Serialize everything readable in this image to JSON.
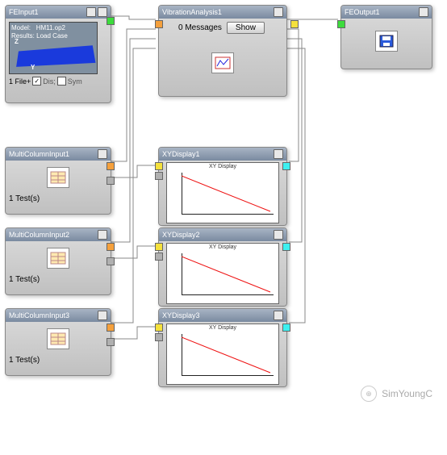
{
  "blocks": {
    "feinput": {
      "title": "FEInput1",
      "model_label": "Model:",
      "model_value": "HM11.op2",
      "results_label": "Results:",
      "results_value": "Load Case",
      "axis_z": "Z",
      "axis_y": "Y",
      "file_count": "1 File+",
      "dis_label": "Dis;",
      "sym_label": "Sym"
    },
    "vibration": {
      "title": "VibrationAnalysis1",
      "messages": "0 Messages",
      "show": "Show"
    },
    "feoutput": {
      "title": "FEOutput1"
    },
    "mci1": {
      "title": "MultiColumnInput1",
      "tests": "1 Test(s)"
    },
    "mci2": {
      "title": "MultiColumnInput2",
      "tests": "1 Test(s)"
    },
    "mci3": {
      "title": "MultiColumnInput3",
      "tests": "1 Test(s)"
    },
    "xy1": {
      "title": "XYDisplay1",
      "plot_title": "XY Display"
    },
    "xy2": {
      "title": "XYDisplay2",
      "plot_title": "XY Display"
    },
    "xy3": {
      "title": "XYDisplay3",
      "plot_title": "XY Display"
    }
  },
  "watermark": "SimYoungC",
  "chart_data": [
    {
      "type": "line",
      "title": "XY Display",
      "x": [
        0,
        100
      ],
      "y": [
        1.0,
        0.1
      ],
      "xlim": [
        0,
        100
      ],
      "ylim": [
        0,
        1.0
      ]
    },
    {
      "type": "line",
      "title": "XY Display",
      "x": [
        0,
        100
      ],
      "y": [
        1.0,
        0.1
      ],
      "xlim": [
        0,
        100
      ],
      "ylim": [
        0,
        1.0
      ]
    },
    {
      "type": "line",
      "title": "XY Display",
      "x": [
        0,
        100
      ],
      "y": [
        1.0,
        0.1
      ],
      "xlim": [
        0,
        100
      ],
      "ylim": [
        0,
        1.0
      ]
    }
  ]
}
